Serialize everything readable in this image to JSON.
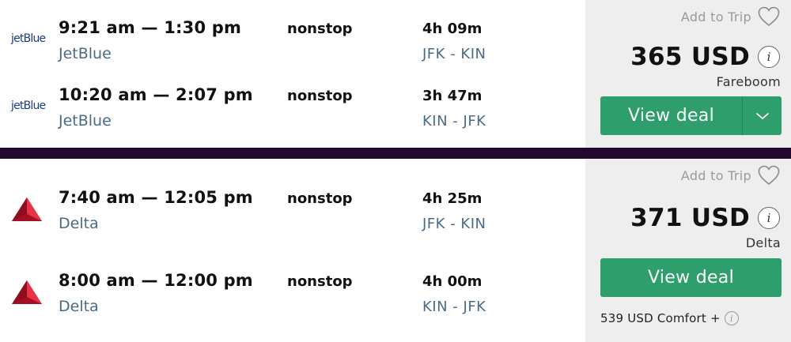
{
  "results": [
    {
      "legs": [
        {
          "logo": "jetBlue",
          "logo_icon": "jetblue-logo",
          "times": "9:21 am — 1:30 pm",
          "airline": "JetBlue",
          "stops": "nonstop",
          "duration": "4h 09m",
          "route": "JFK - KIN"
        },
        {
          "logo": "jetBlue",
          "logo_icon": "jetblue-logo",
          "times": "10:20 am — 2:07 pm",
          "airline": "JetBlue",
          "stops": "nonstop",
          "duration": "3h 47m",
          "route": "KIN - JFK"
        }
      ],
      "add_to_trip": "Add to Trip",
      "price": "365 USD",
      "info_glyph": "i",
      "provider": "Fareboom",
      "deal_label": "View deal"
    },
    {
      "legs": [
        {
          "logo_icon": "delta-logo",
          "times": "7:40 am — 12:05 pm",
          "airline": "Delta",
          "stops": "nonstop",
          "duration": "4h 25m",
          "route": "JFK - KIN"
        },
        {
          "logo_icon": "delta-logo",
          "times": "8:00 am — 12:00 pm",
          "airline": "Delta",
          "stops": "nonstop",
          "duration": "4h 00m",
          "route": "KIN - JFK"
        }
      ],
      "add_to_trip": "Add to Trip",
      "price": "371 USD",
      "info_glyph": "i",
      "provider": "Delta",
      "deal_label": "View deal",
      "extra_fare": "539 USD Comfort +"
    }
  ],
  "colors": {
    "accent_green": "#2e9e6c",
    "divider": "#21092f",
    "secondary_text": "#4a6b86",
    "jetblue_blue": "#1b3c80",
    "delta_red": "#c8102e",
    "sidebar_bg": "#eeeeee"
  },
  "icons": [
    "heart-icon",
    "info-icon",
    "chevron-down-icon",
    "jetblue-logo",
    "delta-logo"
  ]
}
